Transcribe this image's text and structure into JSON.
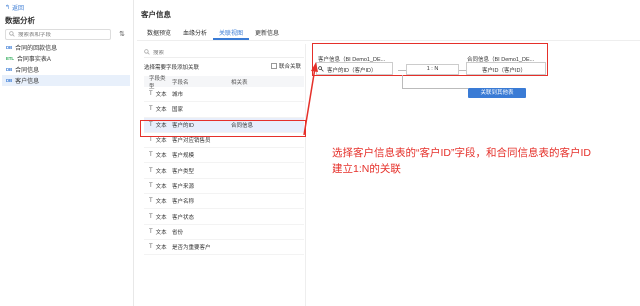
{
  "sidebar": {
    "back_label": "返回",
    "title": "数据分析",
    "search_placeholder": "搜索表和字段",
    "items": [
      {
        "tag": "DB",
        "label": "合同的回款信息"
      },
      {
        "tag": "ETL",
        "label": "合同事实表A"
      },
      {
        "tag": "DB",
        "label": "合同信息"
      },
      {
        "tag": "DB",
        "label": "客户信息"
      }
    ]
  },
  "header": {
    "title": "客户信息",
    "tabs": [
      "数据预览",
      "血缘分析",
      "关联视图",
      "更新信息"
    ],
    "active_tab": 2
  },
  "fields": {
    "search_placeholder": "搜索",
    "hint": "选择需要字段添加关联",
    "checkbox_label": "联合关联",
    "columns": [
      "字段类型",
      "字段名",
      "相关表"
    ],
    "rows": [
      {
        "type": "文本",
        "name": "城市",
        "related": ""
      },
      {
        "type": "文本",
        "name": "国家",
        "related": ""
      },
      {
        "type": "文本",
        "name": "客户的ID",
        "related": "合同信息"
      },
      {
        "type": "文本",
        "name": "客户对应销售员",
        "related": ""
      },
      {
        "type": "文本",
        "name": "客户规模",
        "related": ""
      },
      {
        "type": "文本",
        "name": "客户类型",
        "related": ""
      },
      {
        "type": "文本",
        "name": "客户来源",
        "related": ""
      },
      {
        "type": "文本",
        "name": "客户名称",
        "related": ""
      },
      {
        "type": "文本",
        "name": "客户状态",
        "related": ""
      },
      {
        "type": "文本",
        "name": "省份",
        "related": ""
      },
      {
        "type": "文本",
        "name": "是否为重要客户",
        "related": ""
      }
    ]
  },
  "relation": {
    "left_table": "客户信息（BI Demo1_DE...",
    "right_table": "合同信息（BI Demo1_DE...",
    "left_field": "客户的ID（客户ID）",
    "right_field": "客户ID（客户ID）",
    "cardinality": "1 : N",
    "add_button": "关联到其他表"
  },
  "annotation": {
    "line1": "选择客户信息表的“客户ID”字段，和合同信息表的客户ID",
    "line2": "建立1:N的关联"
  },
  "colors": {
    "accent": "#3a7bd5",
    "highlight": "#e5302a",
    "etl": "#2eab59"
  }
}
